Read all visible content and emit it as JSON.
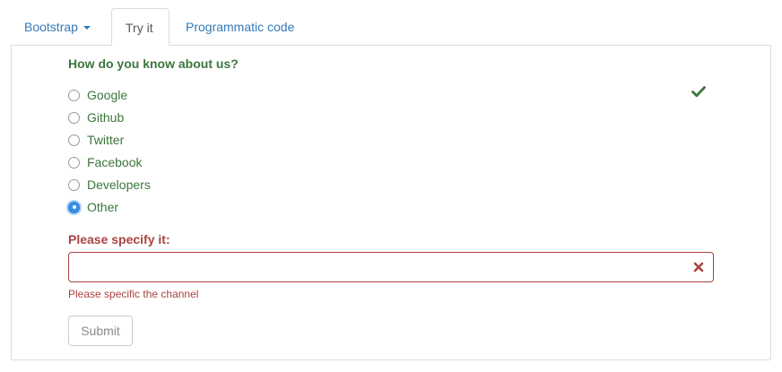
{
  "tabs": [
    {
      "label": "Bootstrap",
      "has_caret": true
    },
    {
      "label": "Try it",
      "active": true
    },
    {
      "label": "Programmatic code"
    }
  ],
  "form": {
    "question": "How do you know about us?",
    "options": [
      {
        "label": "Google",
        "checked": false
      },
      {
        "label": "Github",
        "checked": false
      },
      {
        "label": "Twitter",
        "checked": false
      },
      {
        "label": "Facebook",
        "checked": false
      },
      {
        "label": "Developers",
        "checked": false
      },
      {
        "label": "Other",
        "checked": true
      }
    ],
    "specify_label": "Please specify it:",
    "specify_value": "",
    "error_message": "Please specific the channel",
    "submit_label": "Submit"
  },
  "icons": {
    "valid": "check-icon",
    "invalid": "x-icon",
    "dropdown": "caret-down-icon"
  },
  "colors": {
    "success": "#3c763d",
    "error": "#a94442",
    "link": "#337ab7",
    "border": "#dddddd"
  }
}
